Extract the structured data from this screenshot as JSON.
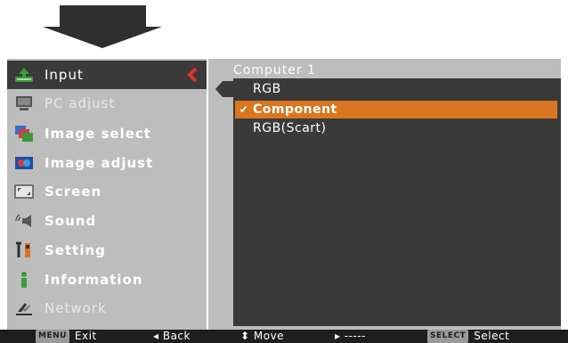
{
  "menu": {
    "items": [
      {
        "label": "Input",
        "icon": "input-icon",
        "active": true
      },
      {
        "label": "PC adjust",
        "icon": "pc-adjust-icon",
        "dim": true
      },
      {
        "label": "Image select",
        "icon": "image-select-icon"
      },
      {
        "label": "Image adjust",
        "icon": "image-adjust-icon"
      },
      {
        "label": "Screen",
        "icon": "screen-icon"
      },
      {
        "label": "Sound",
        "icon": "sound-icon"
      },
      {
        "label": "Setting",
        "icon": "setting-icon"
      },
      {
        "label": "Information",
        "icon": "information-icon"
      },
      {
        "label": "Network",
        "icon": "network-icon",
        "dim": true
      }
    ]
  },
  "panel": {
    "title": "Computer 1",
    "options": [
      {
        "label": "RGB"
      },
      {
        "label": "Component",
        "selected": true,
        "check": "✔"
      },
      {
        "label": "RGB(Scart)"
      }
    ]
  },
  "bar": {
    "exit_key": "MENU",
    "exit": "Exit",
    "back": "◂ Back",
    "move": "⬍ Move",
    "next": "▸ -----",
    "select_key": "SELECT",
    "select": "Select"
  },
  "colors": {
    "accent": "#d9761f",
    "panel": "#3a3a3a",
    "frame": "#bdbdbd",
    "chevron": "#e0302a"
  }
}
